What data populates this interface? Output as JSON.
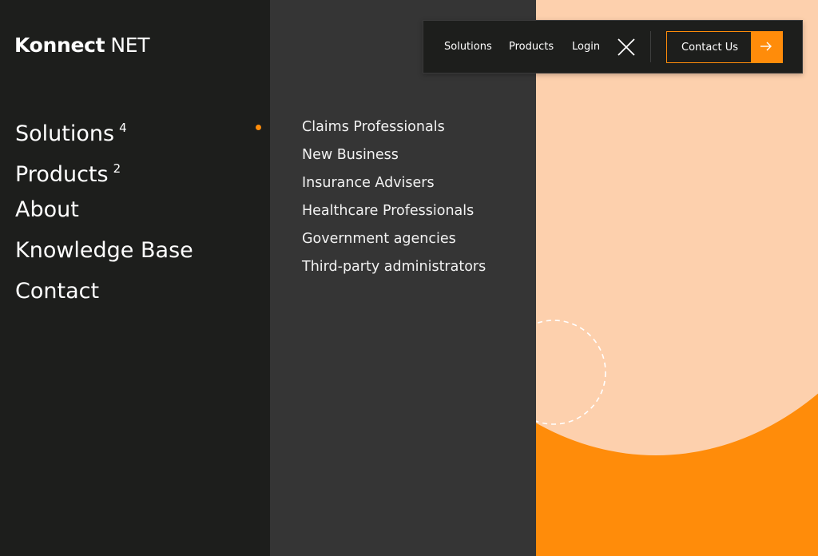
{
  "brand": {
    "name_bold": "Konnect",
    "name_light": "NET"
  },
  "topbar": {
    "links": [
      "Solutions",
      "Products",
      "Login"
    ],
    "close_icon": "close-icon",
    "contact_label": "Contact Us",
    "contact_icon": "arrow-right-icon"
  },
  "menu": {
    "items": [
      {
        "label": "Solutions",
        "count": "4"
      },
      {
        "label": "Products",
        "count": "2"
      },
      {
        "label": "About",
        "count": ""
      },
      {
        "label": "Knowledge Base",
        "count": ""
      },
      {
        "label": "Contact",
        "count": ""
      }
    ],
    "active_index": 0
  },
  "submenu": {
    "items": [
      "Claims Professionals",
      "New Business",
      "Insurance Advisers",
      "Healthcare Professionals",
      "Government agencies",
      "Third-party administrators"
    ]
  },
  "colors": {
    "accent": "#ff8c0a",
    "peach": "#fdd0ad",
    "dark": "#1d1e1c",
    "panel": "#353535"
  }
}
